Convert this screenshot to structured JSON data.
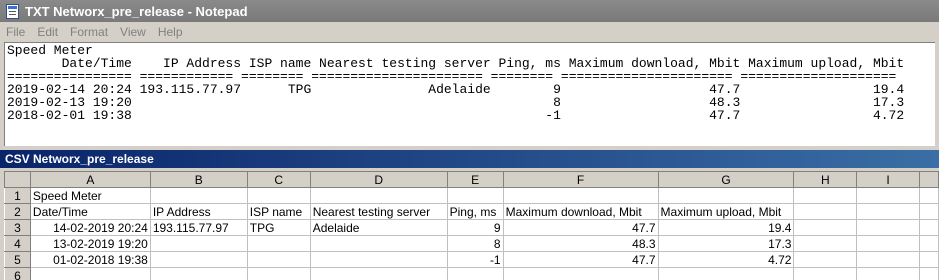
{
  "notepad": {
    "title": "TXT Networx_pre_release - Notepad",
    "menu": [
      "File",
      "Edit",
      "Format",
      "View",
      "Help"
    ],
    "content": "Speed Meter\n       Date/Time    IP Address ISP name Nearest testing server Ping, ms Maximum download, Mbit Maximum upload, Mbit\n================ ============ ======== ====================== ======== ====================== ====================\n2019-02-14 20:24 193.115.77.97      TPG               Adelaide        9                   47.7                 19.4\n2019-02-13 19:20                                                      8                   48.3                 17.3\n2018-02-01 19:38                                                     -1                   47.7                 4.72"
  },
  "csv": {
    "title": "CSV Networx_pre_release",
    "columns": [
      "A",
      "B",
      "C",
      "D",
      "E",
      "F",
      "G",
      "H",
      "I"
    ],
    "row_numbers": [
      "1",
      "2",
      "3",
      "4",
      "5",
      "6"
    ],
    "rows": [
      [
        "Speed Meter",
        "",
        "",
        "",
        "",
        "",
        "",
        "",
        ""
      ],
      [
        "Date/Time",
        "IP Address",
        "ISP name",
        "Nearest testing server",
        "Ping, ms",
        "Maximum download, Mbit",
        "Maximum upload, Mbit",
        "",
        ""
      ],
      [
        "14-02-2019 20:24",
        "193.115.77.97",
        "TPG",
        "Adelaide",
        "9",
        "47.7",
        "19.4",
        "",
        ""
      ],
      [
        "13-02-2019 19:20",
        "",
        "",
        "",
        "8",
        "48.3",
        "17.3",
        "",
        ""
      ],
      [
        "01-02-2018 19:38",
        "",
        "",
        "",
        "-1",
        "47.7",
        "4.72",
        "",
        ""
      ],
      [
        "",
        "",
        "",
        "",
        "",
        "",
        "",
        "",
        ""
      ]
    ]
  }
}
